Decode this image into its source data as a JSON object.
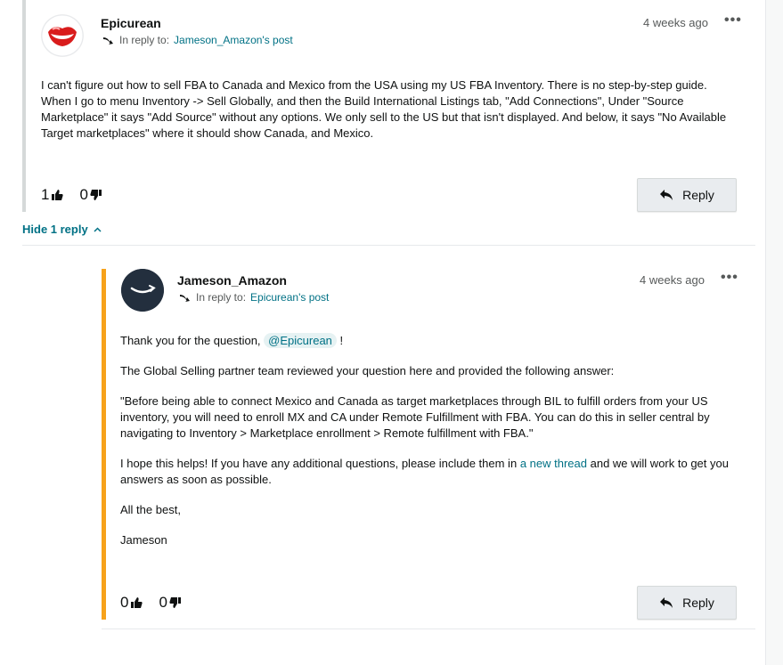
{
  "post1": {
    "author": "Epicurean",
    "reply_prefix": "In reply to:",
    "reply_link": "Jameson_Amazon's post",
    "time": "4 weeks ago",
    "body": "I can't figure out how to sell FBA to Canada and Mexico from the USA using my US FBA Inventory. There is no step-by-step guide. When I go to menu Inventory -> Sell Globally, and then the Build International Listings tab, \"Add Connections\", Under \"Source Marketplace\" it says \"Add Source\" without any options. We only sell to the US but that isn't displayed. And below, it says \"No Available Target marketplaces\" where it should show Canada, and Mexico.",
    "upvotes": "1",
    "downvotes": "0",
    "reply_label": "Reply"
  },
  "hide_replies_label": "Hide 1 reply",
  "post2": {
    "author": "Jameson_Amazon",
    "reply_prefix": "In reply to:",
    "reply_link": "Epicurean's post",
    "time": "4 weeks ago",
    "para1_prefix": "Thank you for the question,",
    "mention": "@Epicurean",
    "para1_suffix": "!",
    "para2": "The Global Selling partner team reviewed your question here and provided the following answer:",
    "para3": "\"Before being able to connect Mexico and Canada as target marketplaces through BIL to fulfill orders from your US inventory, you will need to enroll MX and CA under Remote Fulfillment with FBA. You can do this in seller central by navigating to Inventory > Marketplace enrollment > Remote fulfillment with FBA.\"",
    "para4_prefix": "I hope this helps! If you have any additional questions, please include them in",
    "para4_link": "a new thread",
    "para4_suffix": "and we will work to get you answers as soon as possible.",
    "para5": "All the best,",
    "para6": "Jameson",
    "upvotes": "0",
    "downvotes": "0",
    "reply_label": "Reply"
  },
  "icons": {
    "more": "more-options-icon",
    "thumbs_up": "thumbs-up-icon",
    "thumbs_down": "thumbs-down-icon",
    "reply": "reply-arrow-icon",
    "chevron": "chevron-up-icon"
  },
  "colors": {
    "link": "#007185",
    "accent_border": "#f7a21b",
    "quote_border": "#d5d9d9",
    "button_bg": "#e9ecef"
  }
}
